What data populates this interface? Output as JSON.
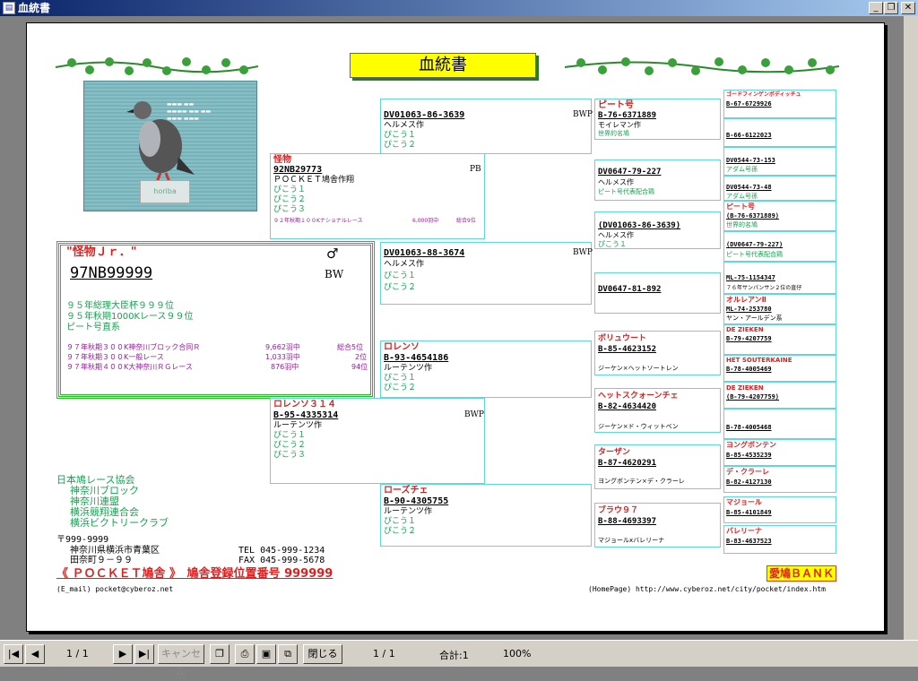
{
  "window": {
    "title": "血統書"
  },
  "doc": {
    "title": "血統書",
    "main": {
      "name": "\"怪物Ｊｒ．\"",
      "sex_symbol": "♂",
      "ring": "97NB99999",
      "color": "BW",
      "records": [
        "９５年総理大臣杯９９９位",
        "９５年秋期1000Kレース９９位",
        "ピート号直系"
      ],
      "races": [
        {
          "race": "９７年秋期３００K神奈川ブロック合同Ｒ",
          "count": "9,662羽中",
          "place": "総合5位"
        },
        {
          "race": "９７年秋期３００K一般レース",
          "count": "1,033羽中",
          "place": "2位"
        },
        {
          "race": "９７年秋期４００K大神奈川ＲＧレース",
          "count": "876羽中",
          "place": "94位"
        }
      ]
    },
    "sire": {
      "name": "怪物",
      "ring": "92NB29773",
      "color": "PB",
      "breeder": "ＰＯＣＫＥＴ鳩舎作翔",
      "notes": [
        "ぴこう１",
        "ぴこう２",
        "ぴこう３"
      ],
      "race": "９２年秋期１００Kナショナルレース",
      "count": "6,000羽中",
      "place": "総合9位"
    },
    "dam": {
      "name": "ロレンソ３１４",
      "ring": "B-95-4335314",
      "color": "BWP",
      "breeder": "ルーテンツ作",
      "notes": [
        "ぴこう１",
        "ぴこう２",
        "ぴこう３"
      ]
    },
    "g2": [
      {
        "ring": "DV01063-86-3639",
        "color": "BWP",
        "breeder": "ヘルメス作",
        "notes": [
          "ぴこう１",
          "ぴこう２"
        ]
      },
      {
        "ring": "DV01063-88-3674",
        "color": "BWP",
        "breeder": "ヘルメス作",
        "notes": [
          "ぴこう１",
          "ぴこう２"
        ]
      },
      {
        "name": "ロレンソ",
        "ring": "B-93-4654186",
        "breeder": "ルーテンツ作",
        "notes": [
          "ぴこう１",
          "ぴこう２"
        ]
      },
      {
        "name": "ローズチェ",
        "ring": "B-90-4305755",
        "breeder": "ルーテンツ作",
        "notes": [
          "ぴこう１",
          "ぴこう２"
        ]
      }
    ],
    "g3": [
      {
        "name": "ピート号",
        "ring": "B-76-6371889",
        "line1": "モイレマン作",
        "line2": "世界的名鳩"
      },
      {
        "ring": "DV0647-79-227",
        "line1": "ヘルメス作",
        "line2": "ピート号代表配合鶏"
      },
      {
        "ring": "(DV01063-86-3639)",
        "line1": "ヘルメス作",
        "line2": "ぴこう１"
      },
      {
        "ring": "DV0647-81-892"
      },
      {
        "name": "ボリュウート",
        "ring": "B-85-4623152",
        "line1": "ジーケン×ヘットソートレン"
      },
      {
        "name": "ヘットスクォーンチェ",
        "ring": "B-82-4634420",
        "line1": "ジーケン×ド・ウィットベン"
      },
      {
        "name": "ターザン",
        "ring": "B-87-4620291",
        "line1": "ヨングボンテン×デ・クラーレ"
      },
      {
        "name": "ブラウ９７",
        "ring": "B-88-4693397",
        "line1": "マジョールxバレリーナ"
      }
    ],
    "g4": [
      {
        "name": "ゴードフィンゲンボディッチュ",
        "ring": "B-67-6729926"
      },
      {
        "ring": "B-66-6122023"
      },
      {
        "ring": "DV0544-73-153",
        "line1": "アダム号孫"
      },
      {
        "ring": "DV0544-73-48",
        "line1": "アダム号孫"
      },
      {
        "name": "ピート号",
        "ring": "(B-76-6371889)",
        "line1": "世界的名鳩"
      },
      {
        "ring": "(DV0647-79-227)",
        "line1": "ピート号代表配合鶏"
      },
      {
        "ring": "ML-75-1154347",
        "line1": "７６年サンパンサン２位の直仔"
      },
      {
        "name": "オルレアンⅡ",
        "ring": "ML-74-253780",
        "line1": "ヤン・アールデン系"
      },
      {
        "name": "DE ZIEKEN",
        "ring": "B-79-4207759"
      },
      {
        "name": "HET SOUTERKAINE",
        "ring": "B-78-4005469"
      },
      {
        "name": "DE ZIEKEN",
        "ring": "(B-79-4207759)"
      },
      {
        "ring": "B-78-4005468"
      },
      {
        "name": "ヨングボンテン",
        "ring": "B-85-4535239"
      },
      {
        "name": "デ・クラーレ",
        "ring": "B-82-4127130"
      },
      {
        "name": "マジョール",
        "ring": "B-85-4101849"
      },
      {
        "name": "バレリーナ",
        "ring": "B-83-4637523"
      }
    ],
    "assoc": [
      "日本鳩レース協会",
      "神奈川ブロック",
      "神奈川連盟",
      "横浜競翔連合会",
      "横浜ビクトリークラブ"
    ],
    "postal": "〒999-9999",
    "address1": "神奈川県横浜市青葉区",
    "address2": "田奈町９－９９",
    "tel": "TEL 045-999-1234",
    "fax": "FAX 045-999-5678",
    "loft": "《 ＰＯＣＫＥＴ鳩舎 》　鳩舎登録位置番号 999999",
    "email": "(E_mail) pocket@cyberoz.net",
    "homepage": "(HomePage) http://www.cyberoz.net/city/pocket/index.htm",
    "bank": "愛鳩ＢＡＮＫ"
  },
  "toolbar": {
    "page": "1 / 1",
    "cancel": "キャンセル",
    "close": "閉じる",
    "page2": "1 / 1",
    "total": "合計:1",
    "zoom": "100%"
  }
}
